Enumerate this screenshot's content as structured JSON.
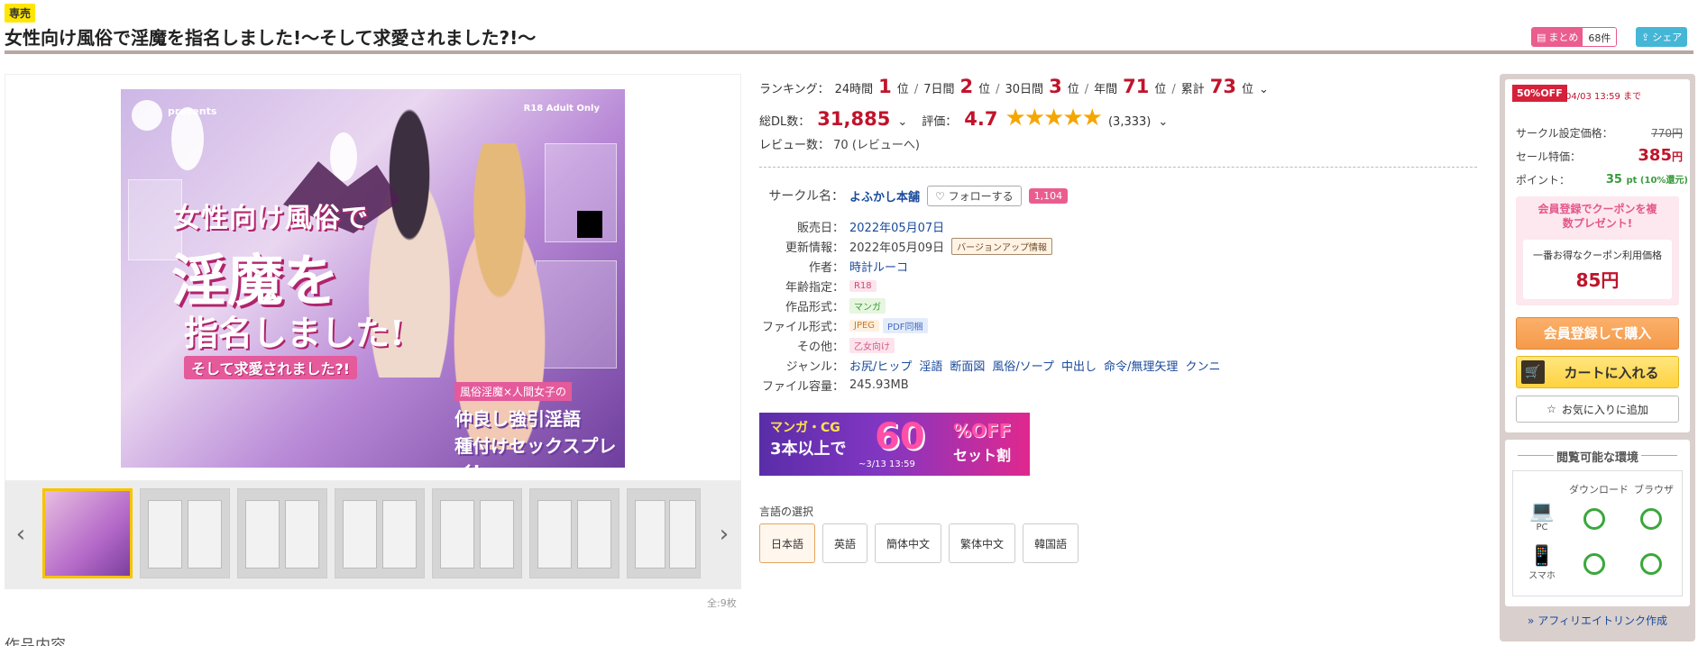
{
  "header": {
    "exclusive_badge": "専売",
    "title": "女性向け風俗で淫魔を指名しました!～そして求愛されました?!～",
    "matome_label": "まとめ",
    "matome_count": "68件",
    "share_label": "シェア"
  },
  "cover": {
    "presents": "presents",
    "r18": "R18 Adult Only",
    "line1": "女性向け風俗で",
    "line2": "淫魔を",
    "line3": "指名しました!",
    "line4": "そして求愛されました?!",
    "tag": "風俗淫魔×人間女子の",
    "tag2": "仲良し強引淫語",
    "tag3": "種付けセックスプレイ!"
  },
  "gallery": {
    "count_label": "全:9枚",
    "prev_arrow": "‹",
    "next_arrow": "›"
  },
  "ranking": {
    "label": "ランキング：",
    "items": [
      {
        "period": "24時間",
        "rank": "1",
        "unit": "位"
      },
      {
        "period": "7日間",
        "rank": "2",
        "unit": "位"
      },
      {
        "period": "30日間",
        "rank": "3",
        "unit": "位"
      },
      {
        "period": "年間",
        "rank": "71",
        "unit": "位"
      },
      {
        "period": "累計",
        "rank": "73",
        "unit": "位"
      }
    ]
  },
  "stats": {
    "dl_label": "総DL数：",
    "dl_value": "31,885",
    "rating_label": "評価：",
    "rating_value": "4.7",
    "stars": "★★★★★",
    "rating_count": "(3,333)",
    "review_label": "レビュー数：",
    "review_value": "70 (レビューへ)"
  },
  "meta": {
    "circle_label": "サークル名：",
    "circle_name": "よふかし本舗",
    "follow_label": "フォローする",
    "follow_count": "1,104",
    "release_label": "販売日：",
    "release_value": "2022年05月07日",
    "update_label": "更新情報：",
    "update_value": "2022年05月09日",
    "update_chip": "バージョンアップ情報",
    "author_label": "作者：",
    "author_value": "時計ルーコ",
    "age_label": "年齢指定：",
    "age_value": "R18",
    "format_label": "作品形式：",
    "format_value": "マンガ",
    "file_label": "ファイル形式：",
    "file_jpeg": "JPEG",
    "file_pdf": "PDF同梱",
    "other_label": "その他：",
    "other_value": "乙女向け",
    "genre_label": "ジャンル：",
    "genres": [
      "お尻/ヒップ",
      "淫語",
      "断面図",
      "風俗/ソープ",
      "中出し",
      "命令/無理矢理",
      "クンニ"
    ],
    "size_label": "ファイル容量：",
    "size_value": "245.93MB"
  },
  "banner": {
    "line1": "マンガ・CG",
    "line2": "3本以上で",
    "pct": "60",
    "off": "%OFF",
    "set": "セット割",
    "until": "~3/13 13:59"
  },
  "language": {
    "label": "言語の選択",
    "options": [
      "日本語",
      "英語",
      "簡体中文",
      "繁体中文",
      "韓国語"
    ]
  },
  "sidebar": {
    "off_badge": "50%OFF",
    "off_until": "04/03 13:59 まで",
    "list_price_label": "サークル設定価格：",
    "list_price": "770円",
    "sale_label": "セール特価：",
    "sale_price": "385",
    "sale_unit": "円",
    "point_label": "ポイント：",
    "point_value": "35",
    "point_unit": "pt (10%還元)",
    "coupon_title": "会員登録でクーポンを複数プレゼント!",
    "coupon_caption": "一番お得なクーポン利用価格",
    "coupon_price": "85円",
    "buy_label": "会員登録して購入",
    "cart_label": "カートに入れる",
    "fav_label": "お気に入りに追加",
    "env_title": "閲覧可能な環境",
    "env_download": "ダウンロード",
    "env_browser": "ブラウザ",
    "env_pc": "PC",
    "env_phone": "スマホ",
    "affiliate": "» アフィリエイトリンク作成"
  },
  "section": {
    "heading": "作品内容"
  }
}
